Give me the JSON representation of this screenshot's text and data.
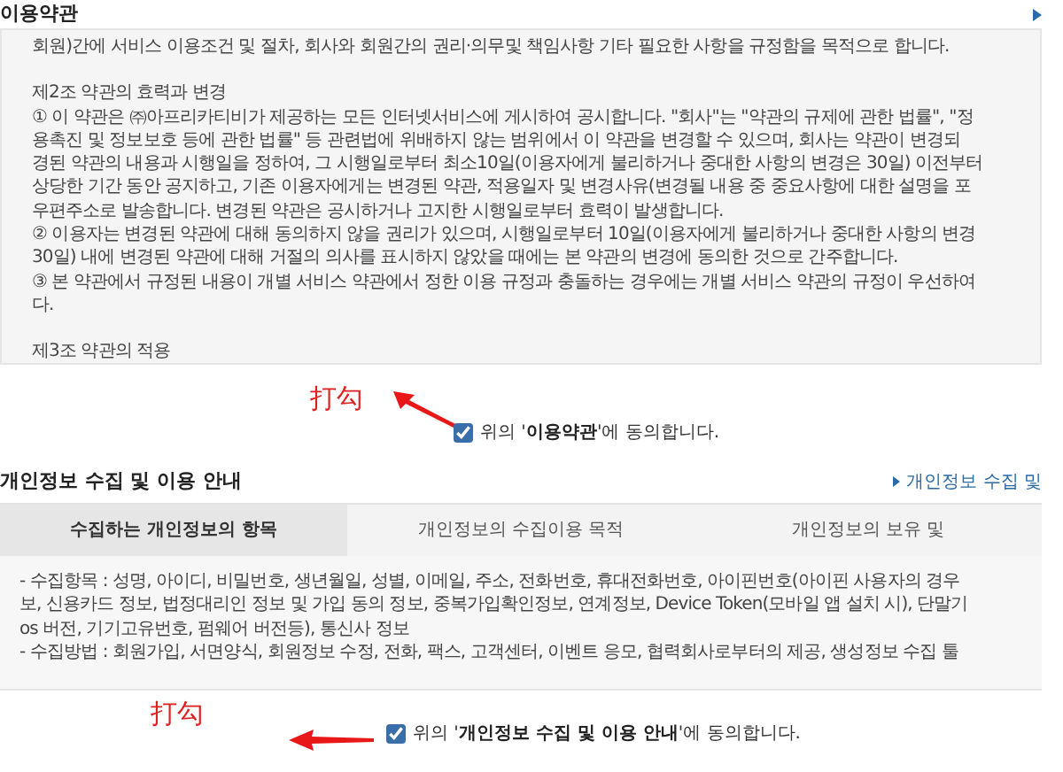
{
  "terms": {
    "title": "이용약관",
    "blocks": [
      [
        "회원)간에 서비스 이용조건 및 절차, 회사와 회원간의 권리·의무및 책임사항 기타 필요한 사항을 규정함을 목적으로 합니다."
      ],
      [
        "제2조 약관의 효력과 변경",
        "① 이 약관은 ㈜아프리카티비가 제공하는 모든 인터넷서비스에 게시하여 공시합니다. \"회사\"는 \"약관의 규제에 관한 법률\", \"정",
        "용촉진 및 정보보호 등에 관한 법률\" 등 관련법에 위배하지 않는 범위에서 이 약관을 변경할 수 있으며, 회사는 약관이 변경되",
        "경된 약관의 내용과 시행일을 정하여, 그 시행일로부터 최소10일(이용자에게 불리하거나 중대한 사항의 변경은 30일) 이전부터",
        "상당한 기간 동안 공지하고, 기존 이용자에게는 변경된 약관, 적용일자 및 변경사유(변경될 내용 중 중요사항에 대한 설명을 포",
        "우편주소로 발송합니다. 변경된 약관은 공시하거나 고지한 시행일로부터 효력이 발생합니다.",
        "② 이용자는 변경된 약관에 대해 동의하지 않을 권리가 있으며, 시행일로부터 10일(이용자에게 불리하거나 중대한 사항의 변경",
        "30일) 내에 변경된 약관에 대해 거절의 의사를 표시하지 않았을 때에는 본 약관의 변경에 동의한 것으로 간주합니다.",
        "③ 본 약관에서 규정된 내용이 개별 서비스 약관에서 정한 이용 규정과 충돌하는 경우에는 개별 서비스 약관의 규정이 우선하여",
        "다."
      ],
      [
        "제3조 약관의 적용"
      ]
    ],
    "annotation": "打勾",
    "consent": {
      "text": "위의 '**이용약관**'에 동의합니다.",
      "checked": true
    }
  },
  "privacy": {
    "title": "개인정보 수집 및 이용 안내",
    "link": "개인정보 수집 및",
    "tabs": [
      {
        "label": "수집하는 개인정보의 항목",
        "selected": true
      },
      {
        "label": "개인정보의 수집이용 목적",
        "selected": false
      },
      {
        "label": "개인정보의 보유 및",
        "selected": false
      }
    ],
    "lines": [
      "- 수집항목 : 성명, 아이디, 비밀번호, 생년월일, 성별, 이메일, 주소, 전화번호, 휴대전화번호, 아이핀번호(아이핀 사용자의 경우",
      "보, 신용카드 정보, 법정대리인 정보 및 가입 동의 정보, 중복가입확인정보, 연계정보, Device Token(모바일 앱 설치 시), 단말기",
      "os 버전, 기기고유번호, 펌웨어 버전등), 통신사 정보",
      "- 수집방법 : 회원가입, 서면양식, 회원정보 수정, 전화, 팩스, 고객센터, 이벤트 응모, 협력회사로부터의 제공, 생성정보 수집 툴"
    ],
    "annotation": "打勾",
    "consent": {
      "text": "위의 '**개인정보 수집 및 이용 안내**'에 동의합니다.",
      "checked": true
    }
  }
}
